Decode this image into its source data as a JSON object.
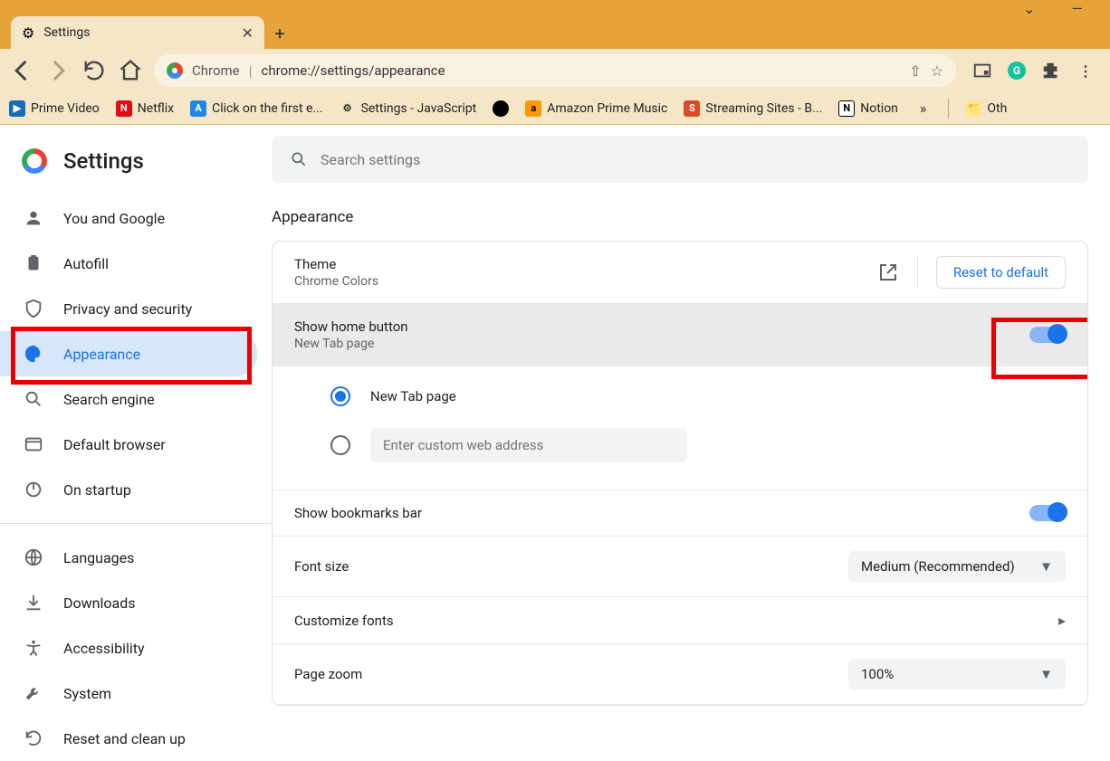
{
  "window": {
    "tab_title": "Settings"
  },
  "omnibox": {
    "scheme_label": "Chrome",
    "url": "chrome://settings/appearance"
  },
  "bookmarks": [
    {
      "label": "Prime Video",
      "bg": "#146eb4",
      "glyph": "▶"
    },
    {
      "label": "Netflix",
      "bg": "#e50914",
      "glyph": "N"
    },
    {
      "label": "Click on the first e...",
      "bg": "#1e88e5",
      "glyph": "A"
    },
    {
      "label": "Settings - JavaScript",
      "bg": "#333",
      "glyph": "⚙"
    },
    {
      "label": "",
      "bg": "#000",
      "glyph": "●"
    },
    {
      "label": "Amazon Prime Music",
      "bg": "#ff9900",
      "glyph": "a"
    },
    {
      "label": "Streaming Sites - B...",
      "bg": "#d94a2b",
      "glyph": "S"
    },
    {
      "label": "Notion",
      "bg": "#fff",
      "glyph": "N",
      "fg": "#000",
      "border": "#000"
    },
    {
      "label": "Oth",
      "bg": "#ffe58f",
      "glyph": "📁"
    }
  ],
  "brand": "Settings",
  "nav": [
    {
      "key": "you",
      "label": "You and Google"
    },
    {
      "key": "autofill",
      "label": "Autofill"
    },
    {
      "key": "privacy",
      "label": "Privacy and security"
    },
    {
      "key": "appearance",
      "label": "Appearance",
      "active": true
    },
    {
      "key": "search",
      "label": "Search engine"
    },
    {
      "key": "default",
      "label": "Default browser"
    },
    {
      "key": "startup",
      "label": "On startup"
    }
  ],
  "nav2": [
    {
      "key": "languages",
      "label": "Languages"
    },
    {
      "key": "downloads",
      "label": "Downloads"
    },
    {
      "key": "accessibility",
      "label": "Accessibility"
    },
    {
      "key": "system",
      "label": "System"
    },
    {
      "key": "reset",
      "label": "Reset and clean up"
    }
  ],
  "search": {
    "placeholder": "Search settings"
  },
  "section": {
    "title": "Appearance"
  },
  "theme": {
    "title": "Theme",
    "sub": "Chrome Colors",
    "reset": "Reset to default"
  },
  "home": {
    "title": "Show home button",
    "sub": "New Tab page",
    "radio1": "New Tab page",
    "custom_placeholder": "Enter custom web address"
  },
  "bookmarks_bar": {
    "title": "Show bookmarks bar"
  },
  "font": {
    "title": "Font size",
    "value": "Medium (Recommended)"
  },
  "customize": {
    "title": "Customize fonts"
  },
  "zoom": {
    "title": "Page zoom",
    "value": "100%"
  }
}
